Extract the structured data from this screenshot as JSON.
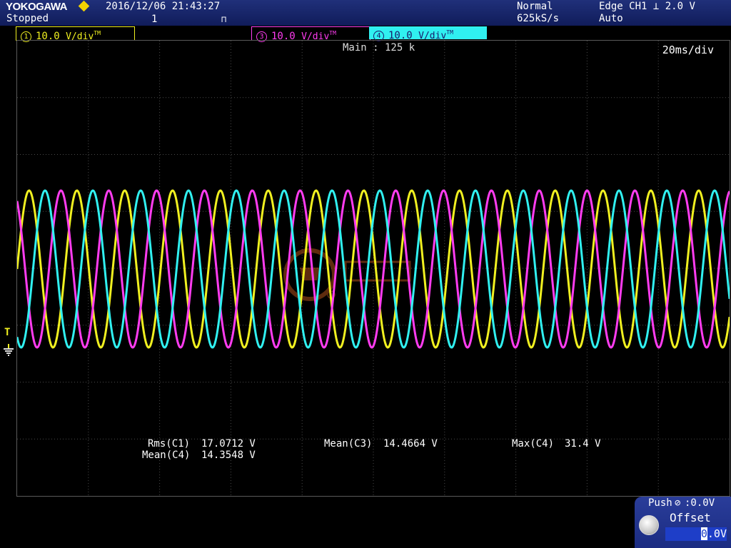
{
  "header": {
    "brand": "YOKOGAWA",
    "status": "Stopped",
    "datetime": "2016/12/06 21:43:27",
    "acq_count": "1",
    "acq_mode": "Normal",
    "sample_rate": "625kS/s",
    "trigger_type": "Edge CH1",
    "trigger_level": "2.0 V",
    "trigger_mode": "Auto"
  },
  "channels": [
    {
      "num": "1",
      "scale": "10.0",
      "unit": "V/div",
      "tm": "TM",
      "color": "#f0f020"
    },
    {
      "num": "3",
      "scale": "10.0",
      "unit": "V/div",
      "tm": "TM",
      "color": "#ff3cf0"
    },
    {
      "num": "4",
      "scale": "10.0",
      "unit": "V/div",
      "tm": "TM",
      "color": "#30f0f0"
    }
  ],
  "display": {
    "main_record": "Main : 125 k",
    "time_div": "20ms/div",
    "grid": true,
    "grid_divisions": {
      "x": 10,
      "y": 8
    }
  },
  "measurements": {
    "rms_c1_label": "Rms(C1)",
    "rms_c1_value": "17.0712 V",
    "mean_c4_label": "Mean(C4)",
    "mean_c4_value": "14.3548 V",
    "mean_c3_label": "Mean(C3)",
    "mean_c3_value": "14.4664 V",
    "max_c4_label": "Max(C4)",
    "max_c4_value": "31.4 V"
  },
  "offset_panel": {
    "push_label": "Push",
    "push_value": ":0.0V",
    "title": "Offset",
    "value_cursor": "0",
    "value_rest": ".0V"
  },
  "icons": [
    "brand-diamond-icon",
    "trigger-edge-icon",
    "trigger-level-marker-icon",
    "ground-marker-icon",
    "offset-knob-icon"
  ],
  "colors": {
    "ch1": "#f0f020",
    "ch3": "#ff3cf0",
    "ch4": "#30f0f0",
    "header_bg": "#1a2a70",
    "grid": "#4a4a4a"
  }
}
